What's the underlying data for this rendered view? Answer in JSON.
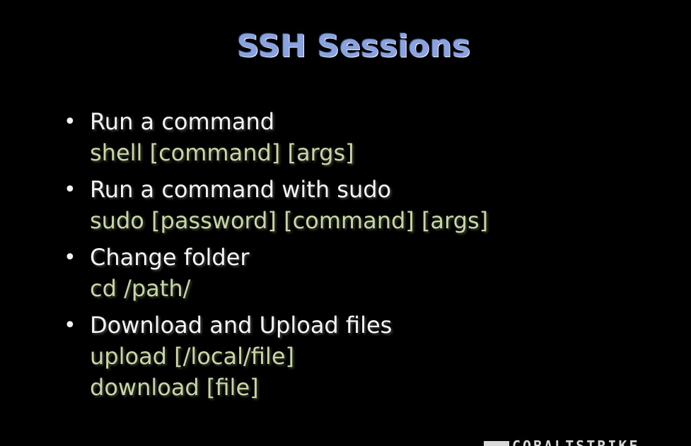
{
  "slide": {
    "title": "SSH Sessions",
    "bullets": [
      {
        "heading": "Run a command",
        "commands": [
          "shell [command] [args]"
        ]
      },
      {
        "heading": "Run a command with sudo",
        "commands": [
          "sudo [password] [command] [args]"
        ]
      },
      {
        "heading": "Change folder",
        "commands": [
          "cd /path/"
        ]
      },
      {
        "heading": "Download and Upload files",
        "commands": [
          "upload [/local/file]",
          "download [file]"
        ]
      }
    ],
    "bullet_glyph": "•",
    "logo_text": "COBALTSTRIKE"
  },
  "colors": {
    "background": "#000000",
    "title": "#8aa3df",
    "heading_text": "#f4f4f4",
    "command_text": "#c8d6a7"
  }
}
